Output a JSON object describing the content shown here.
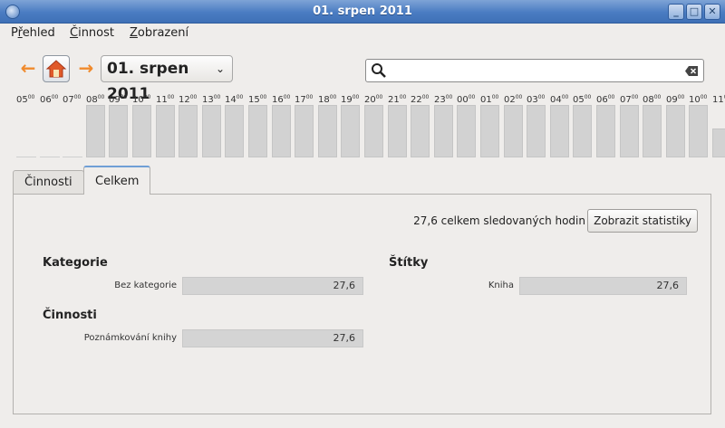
{
  "window": {
    "title": "01. srpen 2011"
  },
  "menu": [
    {
      "pre": "P",
      "acc": "ř",
      "post": "ehled"
    },
    {
      "pre": "",
      "acc": "Č",
      "post": "innost"
    },
    {
      "pre": "",
      "acc": "Z",
      "post": "obrazení"
    }
  ],
  "toolbar": {
    "date": "01. srpen 2011",
    "search_value": ""
  },
  "timeline": {
    "hours": [
      "05",
      "06",
      "07",
      "08",
      "09",
      "10",
      "11",
      "12",
      "13",
      "14",
      "15",
      "16",
      "17",
      "18",
      "19",
      "20",
      "21",
      "22",
      "23",
      "00",
      "01",
      "02",
      "03",
      "04",
      "05",
      "06",
      "07",
      "08",
      "09",
      "10",
      "11"
    ],
    "minutes_sup": "00",
    "filled": [
      0,
      0,
      0,
      1,
      1,
      1,
      1,
      1,
      1,
      1,
      1,
      1,
      1,
      1,
      1,
      1,
      1,
      1,
      1,
      1,
      1,
      1,
      1,
      1,
      1,
      1,
      1,
      1,
      1,
      1,
      0.55
    ]
  },
  "tabs": [
    "Činnosti",
    "Celkem"
  ],
  "totals": {
    "summary": "27,6 celkem sledovaných hodin",
    "stats_button": "Zobrazit statistiky",
    "categories_heading": "Kategorie",
    "categories": [
      {
        "label": "Bez kategorie",
        "value": "27,6"
      }
    ],
    "tags_heading": "Štítky",
    "tags": [
      {
        "label": "Kniha",
        "value": "27,6"
      }
    ],
    "activities_heading": "Činnosti",
    "activities": [
      {
        "label": "Poznámkování knihy",
        "value": "27,6"
      }
    ]
  },
  "colors": {
    "accent": "#f08a2c",
    "titlebar": "#4a7cc2",
    "bar": "#d2d2d2"
  }
}
